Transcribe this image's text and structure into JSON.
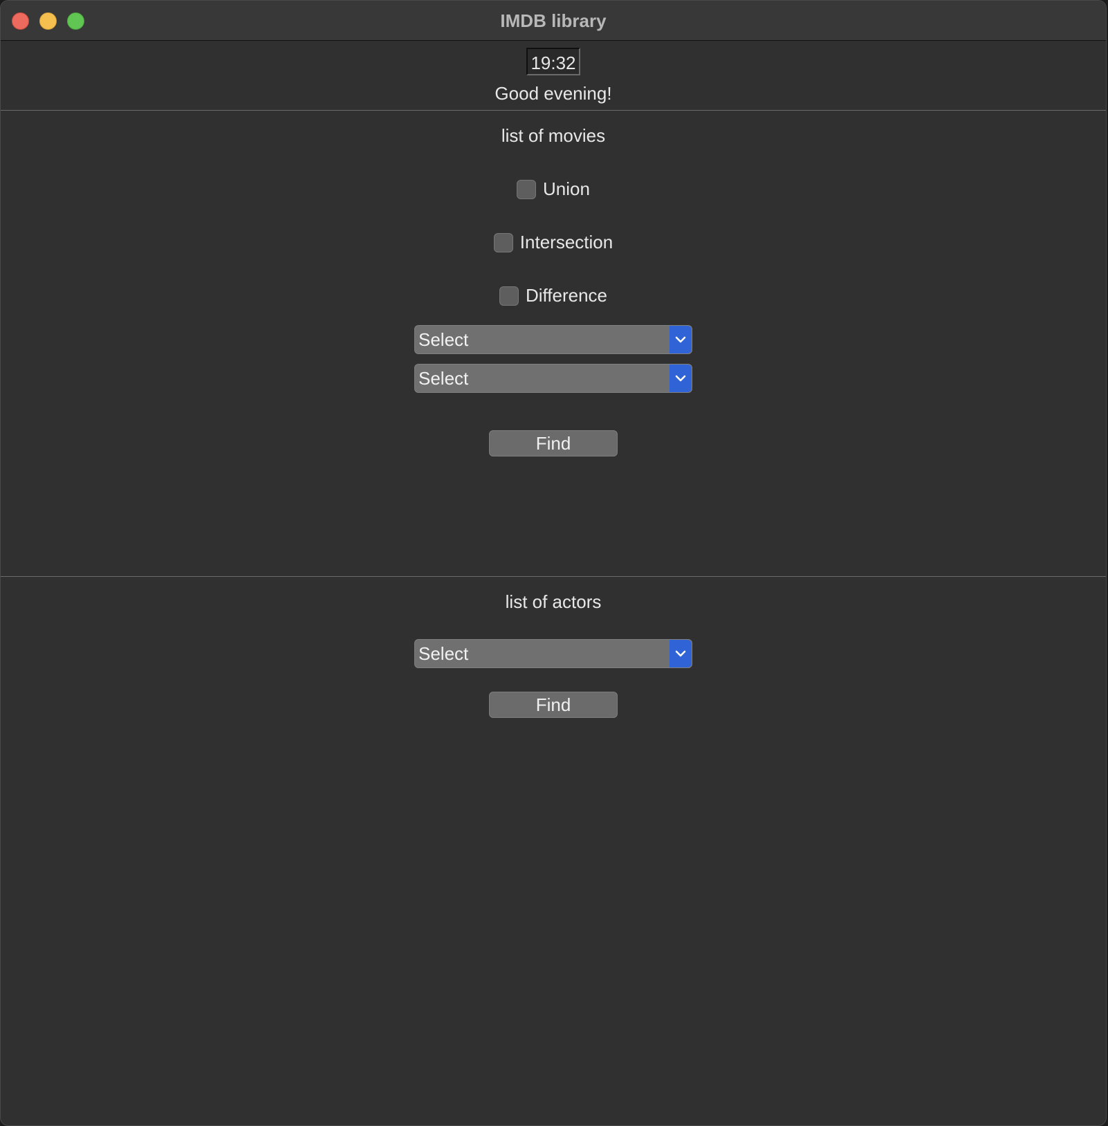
{
  "window": {
    "title": "IMDB library"
  },
  "header": {
    "time": "19:32",
    "greeting": "Good evening!"
  },
  "movies": {
    "title": "list of movies",
    "options": [
      {
        "label": "Union",
        "checked": false
      },
      {
        "label": "Intersection",
        "checked": false
      },
      {
        "label": "Difference",
        "checked": false
      }
    ],
    "select1": "Select",
    "select2": "Select",
    "find_label": "Find"
  },
  "actors": {
    "title": "list of actors",
    "select": "Select",
    "find_label": "Find"
  },
  "colors": {
    "accent": "#2f63d6",
    "background": "#303030",
    "close": "#ed6a5e",
    "minimize": "#f5bf4f",
    "maximize": "#61c554"
  }
}
